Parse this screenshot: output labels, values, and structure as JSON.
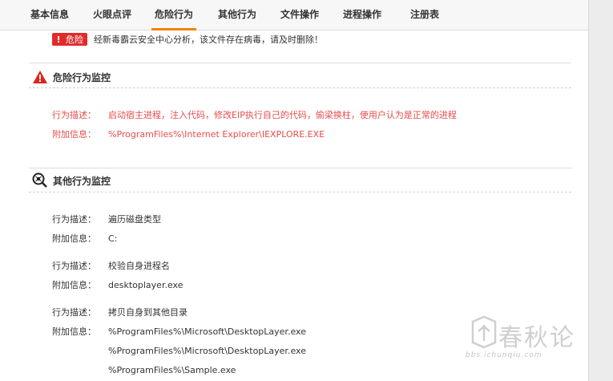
{
  "tabs": [
    {
      "label": "基本信息"
    },
    {
      "label": "火眼点评"
    },
    {
      "label": "危险行为"
    },
    {
      "label": "其他行为"
    },
    {
      "label": "文件操作"
    },
    {
      "label": "进程操作"
    },
    {
      "label": "注册表"
    }
  ],
  "active_tab": "危险行为",
  "alert": {
    "badge": "危险",
    "badge_mark": "!",
    "text": "经新毒霸云安全中心分析，该文件存在病毒，请及时删除！"
  },
  "danger_section": {
    "title": "危险行为监控",
    "rows": [
      {
        "label": "行为描述：",
        "value": "启动宿主进程，注入代码，修改EIP执行自己的代码，偷梁换柱，使用户认为是正常的进程"
      },
      {
        "label": "附加信息：",
        "value": "%ProgramFiles%\\Internet Explorer\\IEXPLORE.EXE"
      }
    ]
  },
  "other_section": {
    "title": "其他行为监控",
    "entries": [
      {
        "desc_label": "行为描述：",
        "desc": "遍历磁盘类型",
        "info_label": "附加信息：",
        "info": [
          "C:"
        ]
      },
      {
        "desc_label": "行为描述：",
        "desc": "校验自身进程名",
        "info_label": "附加信息：",
        "info": [
          "desktoplayer.exe"
        ]
      },
      {
        "desc_label": "行为描述：",
        "desc": "拷贝自身到其他目录",
        "info_label": "附加信息：",
        "info": [
          "%ProgramFiles%\\Microsoft\\DesktopLayer.exe",
          "%ProgramFiles%\\Microsoft\\DesktopLayer.exe",
          "%ProgramFiles%\\Sample.exe"
        ]
      }
    ]
  },
  "watermark": {
    "brand": "春秋论",
    "url": "bbs.ichunqiu.com"
  },
  "colors": {
    "accent": "#f08200",
    "danger": "#e12b2b",
    "danger_text": "#e84c4c"
  }
}
